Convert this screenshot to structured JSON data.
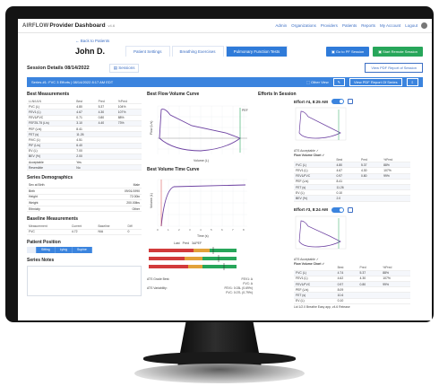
{
  "app": {
    "logo": "AIRFLOW",
    "title": "Provider Dashboard",
    "version": "v4.6",
    "nav": [
      "Admin",
      "Organizations",
      "Providers",
      "Patients",
      "Reports",
      "My Account",
      "Logout"
    ]
  },
  "patient": {
    "back_link": "← Back to Patients",
    "name": "John D.",
    "tabs": [
      {
        "label": "Patient Settings"
      },
      {
        "label": "Breathing Exercises"
      },
      {
        "label": "Pulmonary Function Tests"
      }
    ],
    "actions": {
      "primary": "▣ Go to PF Session",
      "secondary": "▣ Start Remote Session"
    }
  },
  "session": {
    "title": "Session Details 08/14/2022",
    "select": "▤ Sessions",
    "pdf_button": "View PDF Report of Session"
  },
  "series_bar": {
    "label": "Series #1: FVC 3 Efforts | 08/14/2022 8:17 AM EDT",
    "other_view": "⬚ Other View",
    "pdf_button": "View PDF Report Of Series"
  },
  "best_measurements": {
    "title": "Best Measurements",
    "headers": [
      "LLN/ULN",
      "Best",
      "Pred",
      "%Pred"
    ],
    "rows": [
      [
        "FVC (L)",
        "4.80",
        "5.37",
        "104%"
      ],
      [
        "FEV1 (L)",
        "4.67",
        "4.30",
        "107%"
      ],
      [
        "FEV1/FVC",
        "0.71",
        "0.80",
        "88%"
      ],
      [
        "FEF25-75 (L/s)",
        "3.10",
        "4.40",
        "73%"
      ],
      [
        "PEF (L/s)",
        "8.41",
        "",
        ""
      ],
      [
        "FET (s)",
        "11.26",
        "",
        ""
      ],
      [
        "FIVC (L)",
        "4.51",
        "",
        ""
      ],
      [
        "PIF (L/s)",
        "6.40",
        "",
        ""
      ],
      [
        "EV (L)",
        "7.00",
        "",
        ""
      ],
      [
        "BEV (%)",
        "2.00",
        "",
        ""
      ],
      [
        "Acceptable",
        "Yes",
        "",
        ""
      ],
      [
        "Reversible",
        "No",
        "",
        ""
      ]
    ]
  },
  "demographics": {
    "title": "Series Demographics",
    "rows": [
      [
        "Sex at Birth",
        "Male"
      ],
      [
        "Birth",
        "09/01/1990"
      ],
      [
        "Height",
        "72.00in"
      ],
      [
        "Weight",
        "200.00lbs"
      ],
      [
        "Ethnicity",
        "Other"
      ]
    ]
  },
  "baseline": {
    "title": "Baseline Measurements",
    "headers": [
      "Measurement",
      "Current",
      "Baseline",
      "Diff"
    ],
    "rows": [
      [
        "FVC",
        "4.72",
        "N/A",
        "0"
      ]
    ]
  },
  "position": {
    "title": "Patient Position",
    "tabs": [
      "",
      "Sitting",
      "Lying",
      "Supine"
    ]
  },
  "notes": {
    "title": "Series Notes"
  },
  "best_flow": {
    "title": "Best Flow Volume Curve",
    "ylabel": "Flow (L/s)",
    "xlabel": "Volume (L)",
    "peak_label": "PEF"
  },
  "best_volume": {
    "title": "Best Volume Time Curve",
    "ylabel": "Volume (L)",
    "xlabel": "Time (s)"
  },
  "quality": {
    "labels": [
      "Last",
      "Pred",
      "3ΔPEF"
    ],
    "acceptable": "ATS Acceptable ✓",
    "grade_fev1": "ATS Grade Best:",
    "grade_fev1_value": "FEV1: A",
    "grade_fvc_value": "FVC: A",
    "grade_repeat": "ATS Variability:",
    "grade_repeat_value": "FEV1: 0.03L (0.69%)",
    "grade_repeat_value2": "FVC: 0.07L (0.79%)"
  },
  "efforts": {
    "title": "Efforts In Session",
    "items": [
      {
        "label": "Effort #4, 8:25 AM",
        "toggle": "Selected",
        "accept": "ATS Acceptable ✓",
        "subtitle": "Flow Volume Chart ✓",
        "headers": [
          "",
          "Best",
          "Pred",
          "%Pred"
        ],
        "rows": [
          [
            "FVC (L)",
            "4.80",
            "5.37",
            "88%"
          ],
          [
            "FEV1 (L)",
            "4.67",
            "4.30",
            "107%"
          ],
          [
            "FEV1/FVC",
            "0.97",
            "0.80",
            "99%"
          ],
          [
            "PEF (L/s)",
            "8.41",
            "",
            ""
          ],
          [
            "FET (s)",
            "11.26",
            "",
            ""
          ],
          [
            "EV (L)",
            "0.10",
            "",
            ""
          ],
          [
            "BEV (%)",
            "2.0",
            "",
            ""
          ]
        ]
      },
      {
        "label": "Effort #3, 8:24 AM",
        "toggle": "Not Best",
        "accept": "ATS Acceptable ✓",
        "subtitle": "Flow Volume Chart ✓",
        "headers": [
          "",
          "Best",
          "Pred",
          "%Pred"
        ],
        "rows": [
          [
            "FVC (L)",
            "4.74",
            "5.37",
            "88%"
          ],
          [
            "FEV1 (L)",
            "4.62",
            "4.30",
            "107%"
          ],
          [
            "FEV1/FVC",
            "0.97",
            "0.80",
            "99%"
          ],
          [
            "PEF (L/s)",
            "8.09",
            "",
            ""
          ],
          [
            "FET (s)",
            "10.6",
            "",
            ""
          ],
          [
            "EV (L)",
            "0.10",
            "",
            ""
          ]
        ],
        "footnote": "Lid 1/2.0 Breathe Easy app, v4.6 Release"
      }
    ]
  },
  "colors": {
    "accent": "#3b84de",
    "green": "#27a65a",
    "red": "#d23b3b",
    "curve": "#6b3fa0"
  }
}
